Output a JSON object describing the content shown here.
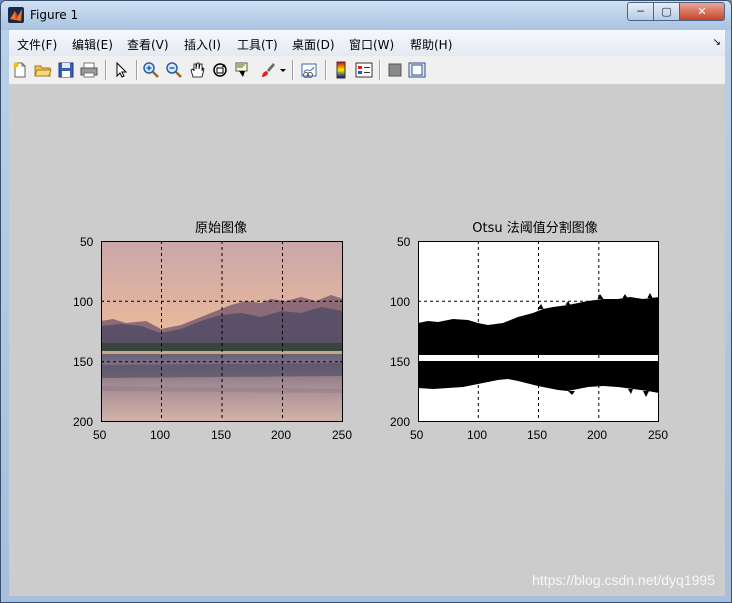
{
  "window": {
    "title": "Figure 1",
    "controls": {
      "minimize": "─",
      "maximize": "▢",
      "close": "✕"
    }
  },
  "menubar": {
    "items": [
      {
        "label": "文件(F)"
      },
      {
        "label": "编辑(E)"
      },
      {
        "label": "查看(V)"
      },
      {
        "label": "插入(I)"
      },
      {
        "label": "工具(T)"
      },
      {
        "label": "桌面(D)"
      },
      {
        "label": "窗口(W)"
      },
      {
        "label": "帮助(H)"
      }
    ]
  },
  "toolbar": {
    "icons": [
      "new-figure-icon",
      "open-file-icon",
      "save-icon",
      "print-icon",
      "edit-plot-arrow-icon",
      "zoom-in-icon",
      "zoom-out-icon",
      "pan-hand-icon",
      "rotate-3d-icon",
      "data-cursor-icon",
      "brush-icon",
      "brush-dropdown-icon",
      "link-plot-icon",
      "colorbar-icon",
      "legend-icon",
      "hide-plot-tools-icon",
      "show-plot-tools-icon"
    ]
  },
  "figure": {
    "background": "#cccccc",
    "left_axes": {
      "title": "原始图像",
      "xticks": [
        "50",
        "100",
        "150",
        "200",
        "250"
      ],
      "yticks": [
        "50",
        "100",
        "150",
        "200"
      ]
    },
    "right_axes": {
      "title": "Otsu 法阈值分割图像",
      "xticks": [
        "50",
        "100",
        "150",
        "200",
        "250"
      ],
      "yticks": [
        "50",
        "100",
        "150",
        "200"
      ]
    }
  },
  "watermark": "https://blog.csdn.net/dyq1995"
}
